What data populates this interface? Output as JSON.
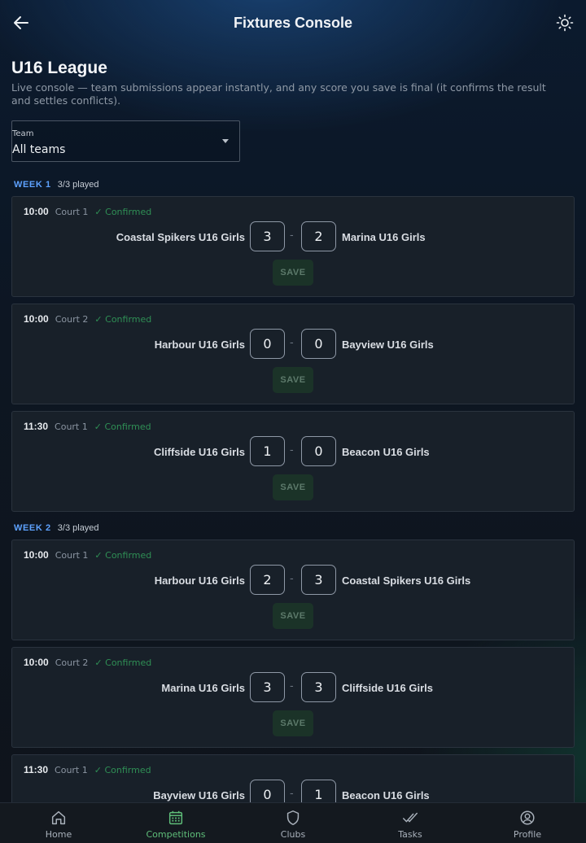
{
  "header": {
    "title": "Fixtures Console",
    "back_icon": "arrow-left-icon",
    "theme_icon": "sun-icon"
  },
  "league": {
    "title": "U16 League",
    "subtitle": "Live console — team submissions appear instantly, and any score you save is final (it confirms the result and settles conflicts)."
  },
  "team_filter": {
    "label": "Team",
    "value": "All teams"
  },
  "weeks": [
    {
      "label": "WEEK 1",
      "played": "3/3 played",
      "fixtures": [
        {
          "time": "10:00",
          "court": "Court 1",
          "status": "✓ Confirmed",
          "home": "Coastal Spikers U16 Girls",
          "home_score": "3",
          "away_score": "2",
          "away": "Marina U16 Girls",
          "save_label": "SAVE"
        },
        {
          "time": "10:00",
          "court": "Court 2",
          "status": "✓ Confirmed",
          "home": "Harbour U16 Girls",
          "home_score": "0",
          "away_score": "0",
          "away": "Bayview U16 Girls",
          "save_label": "SAVE"
        },
        {
          "time": "11:30",
          "court": "Court 1",
          "status": "✓ Confirmed",
          "home": "Cliffside U16 Girls",
          "home_score": "1",
          "away_score": "0",
          "away": "Beacon U16 Girls",
          "save_label": "SAVE"
        }
      ]
    },
    {
      "label": "WEEK 2",
      "played": "3/3 played",
      "fixtures": [
        {
          "time": "10:00",
          "court": "Court 1",
          "status": "✓ Confirmed",
          "home": "Harbour U16 Girls",
          "home_score": "2",
          "away_score": "3",
          "away": "Coastal Spikers U16 Girls",
          "save_label": "SAVE"
        },
        {
          "time": "10:00",
          "court": "Court 2",
          "status": "✓ Confirmed",
          "home": "Marina U16 Girls",
          "home_score": "3",
          "away_score": "3",
          "away": "Cliffside U16 Girls",
          "save_label": "SAVE"
        },
        {
          "time": "11:30",
          "court": "Court 1",
          "status": "✓ Confirmed",
          "home": "Bayview U16 Girls",
          "home_score": "0",
          "away_score": "1",
          "away": "Beacon U16 Girls",
          "save_label": "SAVE"
        }
      ]
    }
  ],
  "nav": [
    {
      "label": "Home",
      "icon": "home-icon",
      "active": false
    },
    {
      "label": "Competitions",
      "icon": "calendar-icon",
      "active": true
    },
    {
      "label": "Clubs",
      "icon": "shield-icon",
      "active": false
    },
    {
      "label": "Tasks",
      "icon": "double-check-icon",
      "active": false
    },
    {
      "label": "Profile",
      "icon": "user-circle-icon",
      "active": false
    }
  ],
  "colors": {
    "accent_week": "#5ea2ff",
    "confirmed": "#2f8f55",
    "nav_active": "#5fbf7a"
  }
}
